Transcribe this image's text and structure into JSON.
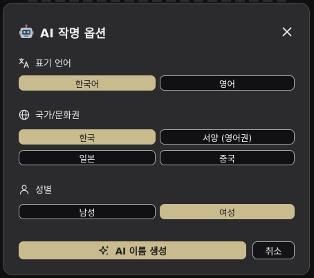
{
  "dialog": {
    "title": "AI 작명 옵션",
    "icons": {
      "title": "robot-icon",
      "close": "close-icon"
    }
  },
  "sections": {
    "language": {
      "label": "표기 언어",
      "icon": "translate-icon",
      "options": [
        {
          "label": "한국어",
          "selected": true
        },
        {
          "label": "영어",
          "selected": false
        }
      ]
    },
    "culture": {
      "label": "국가/문화권",
      "icon": "globe-icon",
      "options": [
        {
          "label": "한국",
          "selected": true
        },
        {
          "label": "서양 (영어권)",
          "selected": false
        },
        {
          "label": "일본",
          "selected": false
        },
        {
          "label": "중국",
          "selected": false
        }
      ]
    },
    "gender": {
      "label": "성별",
      "icon": "person-icon",
      "options": [
        {
          "label": "남성",
          "selected": false
        },
        {
          "label": "여성",
          "selected": true
        }
      ]
    }
  },
  "actions": {
    "generate_label": "AI 이름 생성",
    "generate_icon": "sparkle-icon",
    "cancel_label": "취소"
  },
  "colors": {
    "accent": "#c8bb8e",
    "panel": "#2b2b2d",
    "unselected_bg": "#111113",
    "border": "#a9a9ad"
  }
}
